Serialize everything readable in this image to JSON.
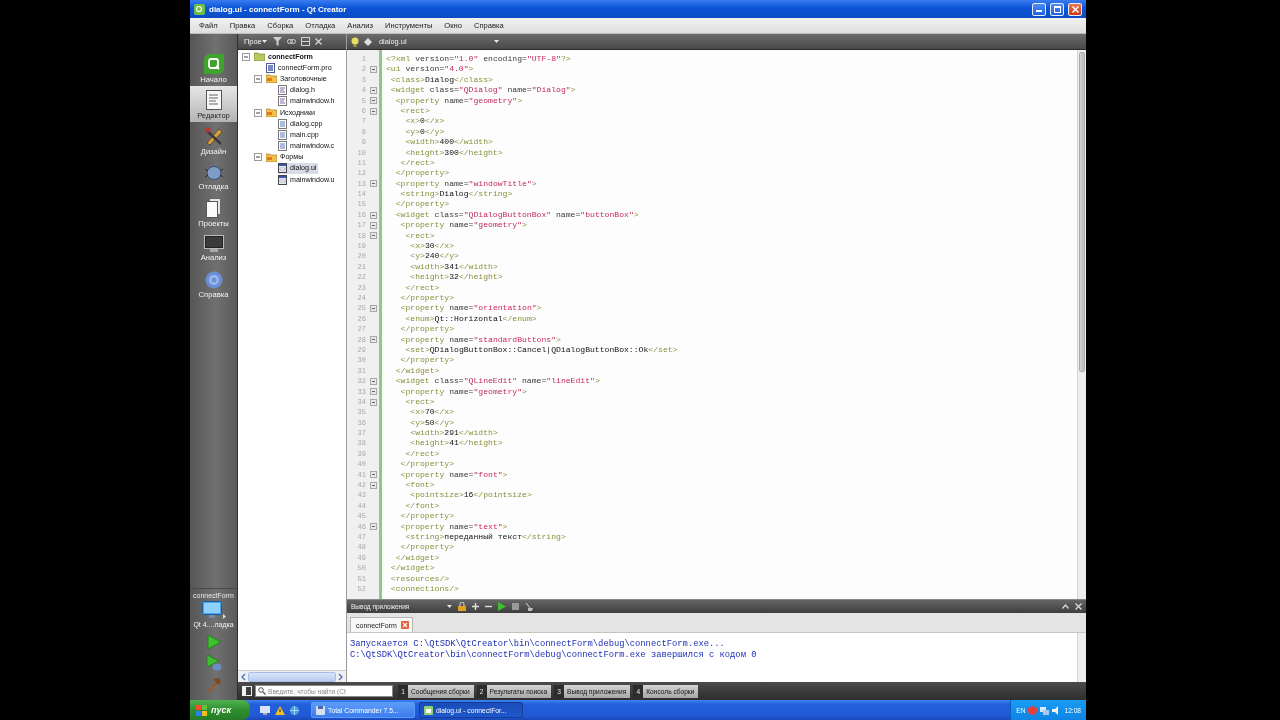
{
  "window": {
    "title": "dialog.ui - connectForm - Qt Creator"
  },
  "menu": [
    "Файл",
    "Правка",
    "Сборка",
    "Отладка",
    "Анализ",
    "Инструменты",
    "Окно",
    "Справка"
  ],
  "modes": [
    {
      "label": "Начало",
      "kind": "welcome",
      "selected": false
    },
    {
      "label": "Редактор",
      "kind": "edit",
      "selected": true
    },
    {
      "label": "Дизайн",
      "kind": "design",
      "selected": false
    },
    {
      "label": "Отладка",
      "kind": "debug",
      "selected": false
    },
    {
      "label": "Проекты",
      "kind": "projects",
      "selected": false
    },
    {
      "label": "Анализ",
      "kind": "analyze",
      "selected": false
    },
    {
      "label": "Справка",
      "kind": "help",
      "selected": false
    }
  ],
  "target": {
    "project": "connectForm",
    "config": "Qt 4....ладка"
  },
  "actions": [
    {
      "kind": "run"
    },
    {
      "kind": "debug"
    },
    {
      "kind": "build"
    }
  ],
  "sidebar": {
    "view": "Прое",
    "tree": [
      {
        "label": "connectForm",
        "kind": "project",
        "expanded": true,
        "selected": false,
        "children": [
          {
            "label": "connectForm.pro",
            "kind": "pro",
            "selected": false
          },
          {
            "label": "Заголовочные",
            "kind": "folder",
            "expanded": true,
            "selected": false,
            "children": [
              {
                "label": "dialog.h",
                "kind": "header",
                "selected": false
              },
              {
                "label": "mainwindow.h",
                "kind": "header",
                "selected": false
              }
            ]
          },
          {
            "label": "Исходники",
            "kind": "folder",
            "expanded": true,
            "selected": false,
            "children": [
              {
                "label": "dialog.cpp",
                "kind": "source",
                "selected": false
              },
              {
                "label": "main.cpp",
                "kind": "source",
                "selected": false
              },
              {
                "label": "mainwindow.c",
                "kind": "source",
                "selected": false
              }
            ]
          },
          {
            "label": "Формы",
            "kind": "folder",
            "expanded": true,
            "selected": false,
            "children": [
              {
                "label": "dialog.ui",
                "kind": "form",
                "selected": true
              },
              {
                "label": "mainwindow.u",
                "kind": "form",
                "selected": false
              }
            ]
          }
        ]
      }
    ]
  },
  "editor": {
    "document": "dialog.ui",
    "lines": [
      {
        "number": "1",
        "text": "<?xml version=\"1.0\" encoding=\"UTF-8\"?>",
        "fold": false
      },
      {
        "number": "2",
        "text": "<ui version=\"4.0\">",
        "fold": true
      },
      {
        "number": "3",
        "text": " <class>Dialog</class>",
        "fold": false
      },
      {
        "number": "4",
        "text": " <widget class=\"QDialog\" name=\"Dialog\">",
        "fold": true
      },
      {
        "number": "5",
        "text": "  <property name=\"geometry\">",
        "fold": true
      },
      {
        "number": "6",
        "text": "   <rect>",
        "fold": true
      },
      {
        "number": "7",
        "text": "    <x>0</x>",
        "fold": false
      },
      {
        "number": "8",
        "text": "    <y>0</y>",
        "fold": false
      },
      {
        "number": "9",
        "text": "    <width>400</width>",
        "fold": false
      },
      {
        "number": "10",
        "text": "    <height>300</height>",
        "fold": false
      },
      {
        "number": "11",
        "text": "   </rect>",
        "fold": false
      },
      {
        "number": "12",
        "text": "  </property>",
        "fold": false
      },
      {
        "number": "13",
        "text": "  <property name=\"windowTitle\">",
        "fold": true
      },
      {
        "number": "14",
        "text": "   <string>Dialog</string>",
        "fold": false
      },
      {
        "number": "15",
        "text": "  </property>",
        "fold": false
      },
      {
        "number": "16",
        "text": "  <widget class=\"QDialogButtonBox\" name=\"buttonBox\">",
        "fold": true
      },
      {
        "number": "17",
        "text": "   <property name=\"geometry\">",
        "fold": true
      },
      {
        "number": "18",
        "text": "    <rect>",
        "fold": true
      },
      {
        "number": "19",
        "text": "     <x>30</x>",
        "fold": false
      },
      {
        "number": "20",
        "text": "     <y>240</y>",
        "fold": false
      },
      {
        "number": "21",
        "text": "     <width>341</width>",
        "fold": false
      },
      {
        "number": "22",
        "text": "     <height>32</height>",
        "fold": false
      },
      {
        "number": "23",
        "text": "    </rect>",
        "fold": false
      },
      {
        "number": "24",
        "text": "   </property>",
        "fold": false
      },
      {
        "number": "25",
        "text": "   <property name=\"orientation\">",
        "fold": true
      },
      {
        "number": "26",
        "text": "    <enum>Qt::Horizontal</enum>",
        "fold": false
      },
      {
        "number": "27",
        "text": "   </property>",
        "fold": false
      },
      {
        "number": "28",
        "text": "   <property name=\"standardButtons\">",
        "fold": true
      },
      {
        "number": "29",
        "text": "    <set>QDialogButtonBox::Cancel|QDialogButtonBox::Ok</set>",
        "fold": false
      },
      {
        "number": "30",
        "text": "   </property>",
        "fold": false
      },
      {
        "number": "31",
        "text": "  </widget>",
        "fold": false
      },
      {
        "number": "32",
        "text": "  <widget class=\"QLineEdit\" name=\"lineEdit\">",
        "fold": true
      },
      {
        "number": "33",
        "text": "   <property name=\"geometry\">",
        "fold": true
      },
      {
        "number": "34",
        "text": "    <rect>",
        "fold": true
      },
      {
        "number": "35",
        "text": "     <x>70</x>",
        "fold": false
      },
      {
        "number": "36",
        "text": "     <y>50</y>",
        "fold": false
      },
      {
        "number": "37",
        "text": "     <width>291</width>",
        "fold": false
      },
      {
        "number": "38",
        "text": "     <height>41</height>",
        "fold": false
      },
      {
        "number": "39",
        "text": "    </rect>",
        "fold": false
      },
      {
        "number": "40",
        "text": "   </property>",
        "fold": false
      },
      {
        "number": "41",
        "text": "   <property name=\"font\">",
        "fold": true
      },
      {
        "number": "42",
        "text": "    <font>",
        "fold": true
      },
      {
        "number": "43",
        "text": "     <pointsize>16</pointsize>",
        "fold": false
      },
      {
        "number": "44",
        "text": "    </font>",
        "fold": false
      },
      {
        "number": "45",
        "text": "   </property>",
        "fold": false
      },
      {
        "number": "46",
        "text": "   <property name=\"text\">",
        "fold": true
      },
      {
        "number": "47",
        "text": "    <string>переданный текст</string>",
        "fold": false
      },
      {
        "number": "48",
        "text": "   </property>",
        "fold": false
      },
      {
        "number": "49",
        "text": "  </widget>",
        "fold": false
      },
      {
        "number": "50",
        "text": " </widget>",
        "fold": false
      },
      {
        "number": "51",
        "text": " <resources/>",
        "fold": false
      },
      {
        "number": "52",
        "text": " <connections/>",
        "fold": false
      }
    ]
  },
  "output": {
    "title": "Вывод приложения",
    "tabs": [
      {
        "label": "connectForm",
        "selected": true
      }
    ],
    "lines": [
      "Запускается C:\\QtSDK\\QtCreator\\bin\\connectForm\\debug\\connectForm.exe...",
      "C:\\QtSDK\\QtCreator\\bin\\connectForm\\debug\\connectForm.exe завершился с кодом 0"
    ]
  },
  "status_bar": {
    "search": {
      "placeholder": "Введите, чтобы найти (Ct"
    },
    "panes": [
      {
        "number": "1",
        "label": "Сообщения сборки"
      },
      {
        "number": "2",
        "label": "Результаты поиска"
      },
      {
        "number": "3",
        "label": "Вывод приложения"
      },
      {
        "number": "4",
        "label": "Консоль сборки"
      }
    ]
  },
  "taskbar": {
    "start": "пуск",
    "tasks": [
      {
        "label": "Total Commander 7.5...",
        "kind": "commander",
        "selected": false
      },
      {
        "label": "dialog.ui - connectFor...",
        "kind": "creator",
        "selected": true
      }
    ],
    "language": "EN",
    "clock": "12:08"
  }
}
